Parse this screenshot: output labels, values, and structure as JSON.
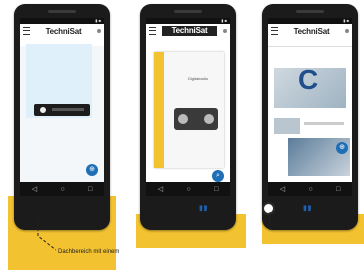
{
  "screens": [
    {
      "brand": "TechniSat",
      "tabs": [
        "",
        "",
        ""
      ],
      "caption": "",
      "fab_icon": "bookmark-icon"
    },
    {
      "brand": "TechniSat",
      "tabs": [],
      "card_text": "Digitalradio",
      "caption": "",
      "fab_icon": "search-icon"
    },
    {
      "brand": "TechniSat",
      "tabs": [
        "",
        "",
        ""
      ],
      "overlay_glyph": "C",
      "fab_icon": "bookmark-icon"
    }
  ],
  "annotations": {
    "quote_glyph": "\"",
    "callout_text": "Dachbereich mit einem"
  },
  "colors": {
    "accent_yellow": "#f2c230",
    "accent_blue": "#1f5fb0",
    "phone_body": "#1b1b1b"
  }
}
